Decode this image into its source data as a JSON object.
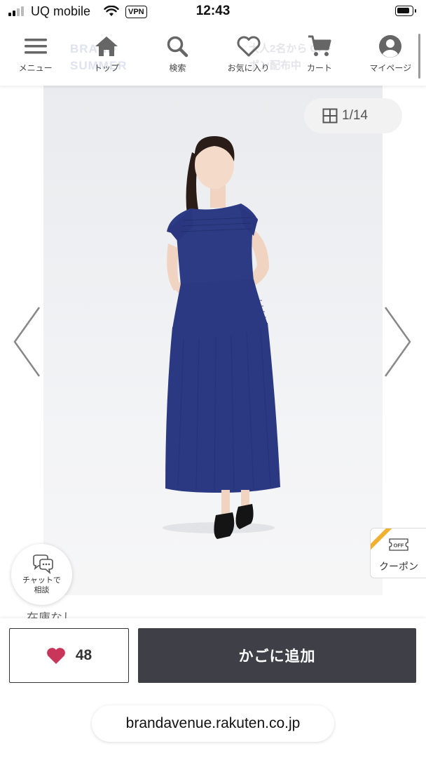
{
  "status_bar": {
    "carrier": "UQ mobile",
    "vpn": "VPN",
    "time": "12:43"
  },
  "nav": {
    "items": [
      {
        "label": "メニュー",
        "icon": "menu-icon"
      },
      {
        "label": "トップ",
        "icon": "home-icon"
      },
      {
        "label": "検索",
        "icon": "search-icon"
      },
      {
        "label": "お気に入り",
        "icon": "heart-icon"
      },
      {
        "label": "カート",
        "icon": "cart-icon"
      },
      {
        "label": "マイページ",
        "icon": "user-icon"
      }
    ],
    "background_text": [
      "BRAND",
      "SUMMER"
    ],
    "background_text_2": [
      "大人2名から OFF",
      "ポン配布中"
    ]
  },
  "gallery": {
    "counter": "1/14"
  },
  "coupon": {
    "badge": "OFF",
    "label": "クーポン"
  },
  "chat": {
    "label_line1": "チャットで",
    "label_line2": "相談"
  },
  "partial_text": "在庫なし",
  "actions": {
    "favorite_count": "48",
    "add_to_cart": "かごに追加"
  },
  "browser": {
    "url": "brandavenue.rakuten.co.jp"
  },
  "colors": {
    "dress": "#2b3a86",
    "cart_button": "#3f4047",
    "heart": "#c8365a",
    "coupon_ribbon": "#f0b030"
  }
}
